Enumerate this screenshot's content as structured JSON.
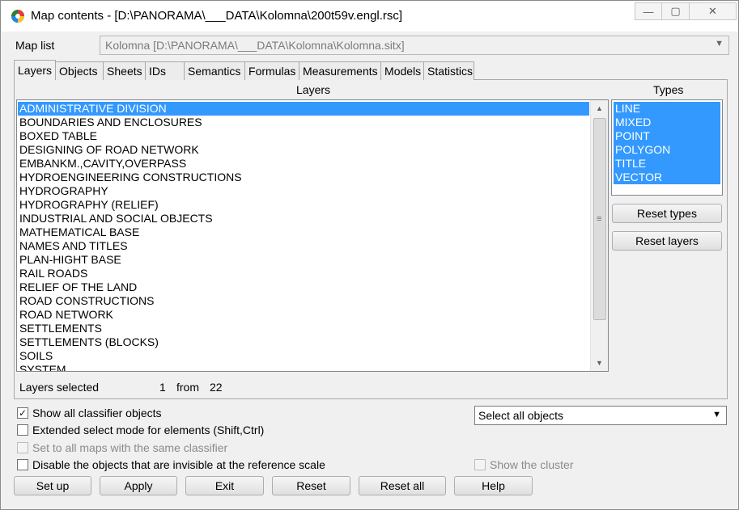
{
  "window": {
    "title": "Map contents - [D:\\PANORAMA\\___DATA\\Kolomna\\200t59v.engl.rsc]",
    "minimize_glyph": "—",
    "maximize_glyph": "▢",
    "close_glyph": "✕"
  },
  "map_list": {
    "label": "Map list",
    "value": "Kolomna [D:\\PANORAMA\\___DATA\\Kolomna\\Kolomna.sitx]"
  },
  "tabs": [
    "Layers",
    "Objects",
    "Sheets",
    "IDs",
    "Semantics",
    "Formulas",
    "Measurements",
    "Models",
    "Statistics"
  ],
  "active_tab": "Layers",
  "layers_panel": {
    "heading": "Layers",
    "items": [
      "ADMINISTRATIVE DIVISION",
      "BOUNDARIES AND ENCLOSURES",
      "BOXED TABLE",
      "DESIGNING OF ROAD NETWORK",
      "EMBANKM.,CAVITY,OVERPASS",
      "HYDROENGINEERING CONSTRUCTIONS",
      "HYDROGRAPHY",
      "HYDROGRAPHY (RELIEF)",
      "INDUSTRIAL AND SOCIAL OBJECTS",
      "MATHEMATICAL BASE",
      "NAMES AND TITLES",
      "PLAN-HIGHT BASE",
      "RAIL ROADS",
      "RELIEF OF THE LAND",
      "ROAD CONSTRUCTIONS",
      "ROAD NETWORK",
      "SETTLEMENTS",
      "SETTLEMENTS (BLOCKS)",
      "SOILS",
      "SYSTEM"
    ],
    "selected_item": "ADMINISTRATIVE DIVISION"
  },
  "types_panel": {
    "heading": "Types",
    "items": [
      "LINE",
      "MIXED",
      "POINT",
      "POLYGON",
      "TITLE",
      "VECTOR"
    ]
  },
  "side_buttons": {
    "reset_types": "Reset types",
    "reset_layers": "Reset layers"
  },
  "status": {
    "label": "Layers selected",
    "count": "1",
    "from_word": "from",
    "total": "22"
  },
  "options": {
    "show_all": {
      "label": "Show all classifier objects",
      "checked": true,
      "check_glyph": "✓"
    },
    "extended": {
      "label": "Extended select mode for elements (Shift,Ctrl)",
      "checked": false
    },
    "same_classifier": {
      "label": "Set to all maps with the same classifier",
      "checked": false,
      "disabled": true
    },
    "disable_invisible": {
      "label": "Disable the objects that are invisible at the reference scale",
      "checked": false
    },
    "show_cluster": {
      "label": "Show the cluster",
      "checked": false,
      "disabled": true
    }
  },
  "object_select": {
    "value": "Select all objects"
  },
  "bottom_buttons": {
    "setup": "Set up",
    "apply": "Apply",
    "exit": "Exit",
    "reset": "Reset",
    "reset_all": "Reset all",
    "help": "Help"
  },
  "glyphs": {
    "dropdown": "▼",
    "scroll_up": "▲",
    "scroll_down": "▼",
    "scroll_grip": "≡"
  },
  "colors": {
    "selection": "#3399ff",
    "window_bg": "#f0f0f0"
  }
}
